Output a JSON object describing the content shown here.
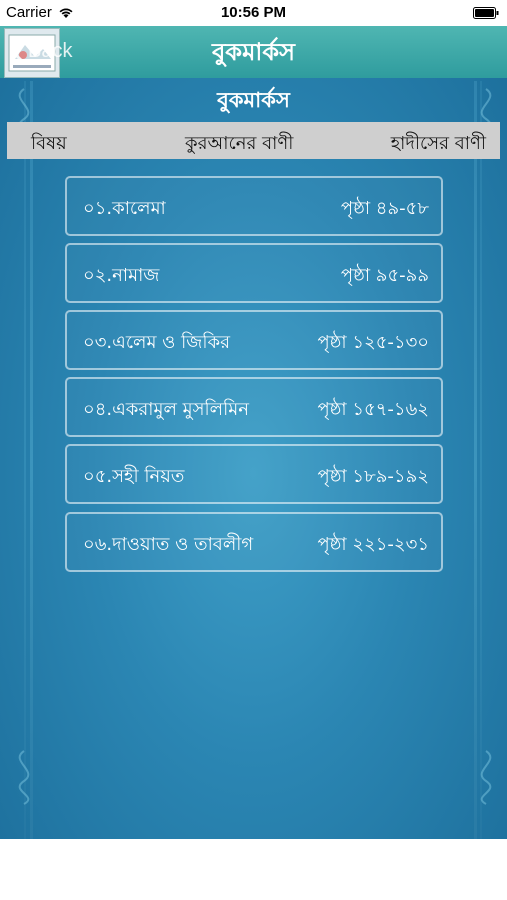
{
  "status_bar": {
    "carrier": "Carrier",
    "time": "10:56 PM"
  },
  "nav": {
    "back_label": "Back",
    "title": "বুকমার্কস"
  },
  "page_heading": "বুকমার্কস",
  "columns": {
    "topic": "বিষয়",
    "quran": "কুরআনের বাণী",
    "hadith": "হাদীসের বাণী"
  },
  "bookmarks": [
    {
      "title": "০১.কালেমা",
      "page": "পৃষ্ঠা ৪৯-৫৮"
    },
    {
      "title": "০২.নামাজ",
      "page": "পৃষ্ঠা ৯৫-৯৯"
    },
    {
      "title": "০৩.এলেম ও জিকির",
      "page": "পৃষ্ঠা ১২৫-১৩০"
    },
    {
      "title": "০৪.একরামুল মুসলিমিন",
      "page": "পৃষ্ঠা ১৫৭-১৬২"
    },
    {
      "title": "০৫.সহী নিয়ত",
      "page": "পৃষ্ঠা ১৮৯-১৯২"
    },
    {
      "title": "০৬.দাওয়াত ও তাবলীগ",
      "page": "পৃষ্ঠা ২২১-২৩১"
    }
  ],
  "colors": {
    "nav_bar": "#3aa7a8",
    "background": "#2b86b3",
    "header_row": "#cfcfcf"
  }
}
